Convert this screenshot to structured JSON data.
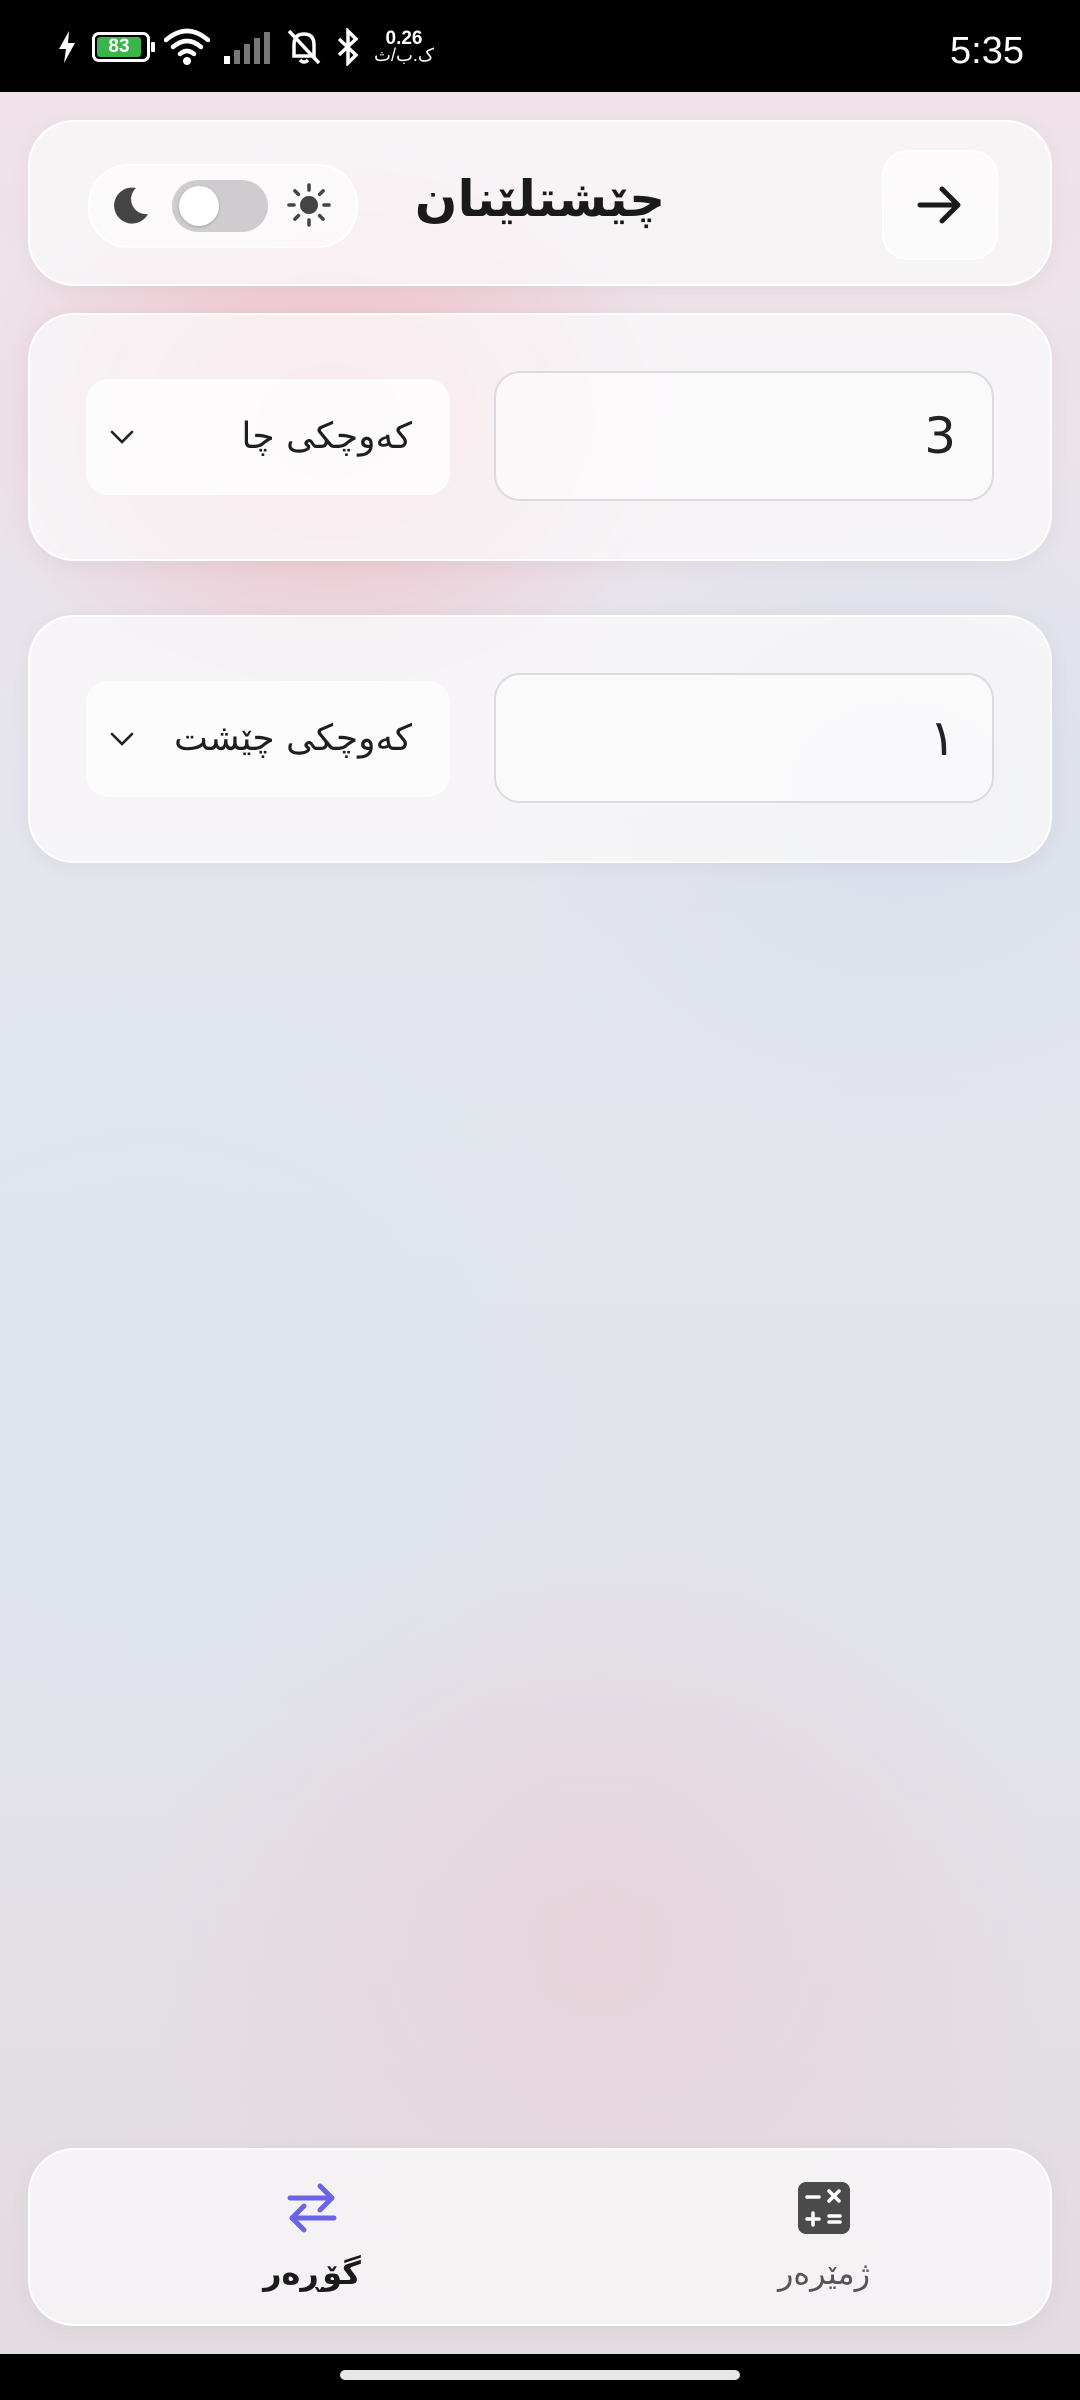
{
  "status_bar": {
    "battery_level": "83",
    "net_speed_value": "0.26",
    "net_speed_unit": "ک.ب/ث",
    "time": "5:35",
    "icons": [
      "charging-icon",
      "battery-icon",
      "wifi-icon",
      "signal-icon",
      "bell-muted-icon",
      "bluetooth-icon"
    ]
  },
  "header": {
    "title": "چێشتلێنان",
    "theme_toggle": {
      "left_icon": "moon-icon",
      "right_icon": "sun-icon",
      "dark_mode": false
    },
    "back_icon": "arrow-right-icon"
  },
  "converter": {
    "from": {
      "value": "3",
      "unit": "کەوچکی چا"
    },
    "to": {
      "value": "١",
      "unit": "کەوچکی چێشت"
    }
  },
  "bottom_nav": {
    "items": [
      {
        "label": "گۆڕەر",
        "icon": "swap-arrows-icon",
        "active": true
      },
      {
        "label": "ژمێرەر",
        "icon": "calculator-icon",
        "active": false
      }
    ]
  },
  "colors": {
    "accent": "#6b63e8",
    "text": "#1a1a1a"
  }
}
